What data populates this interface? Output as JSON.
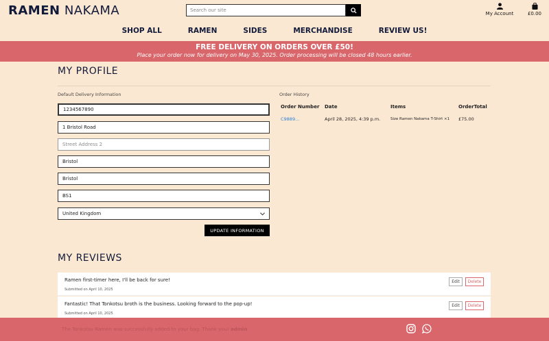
{
  "header": {
    "logo_bold": "RAMEN",
    "logo_light": "NAKAMA",
    "search_placeholder": "Search our site",
    "account_label": "My Account",
    "cart_total": "£0.00"
  },
  "nav": [
    "SHOP ALL",
    "RAMEN",
    "SIDES",
    "MERCHANDISE",
    "REVIEW US!"
  ],
  "banner": {
    "title": "FREE DELIVERY ON ORDERS OVER £50!",
    "subtitle": "Place your order now for delivery on May 30, 2025. Order processing will be closed 48 hours earlier."
  },
  "profile": {
    "title": "MY PROFILE",
    "delivery_label": "Default Delivery Information",
    "fields": {
      "phone": "1234567890",
      "street1": "1 Bristol Road",
      "street2_placeholder": "Street Address 2",
      "town": "Bristol",
      "county": "Bristol",
      "postcode": "BS1",
      "country": "United Kingdom"
    },
    "update_button": "UPDATE INFORMATION"
  },
  "order_history": {
    "label": "Order History",
    "columns": [
      "Order Number",
      "Date",
      "Items",
      "OrderTotal"
    ],
    "rows": [
      {
        "number": "C9889...",
        "date": "April 28, 2025, 4:39 p.m.",
        "items": "Size Ramen Nakama T-Shirt ×1",
        "total": "£75.00"
      }
    ]
  },
  "reviews": {
    "title": "MY REVIEWS",
    "edit_label": "Edit",
    "delete_label": "Delete",
    "items": [
      {
        "text": "Ramen first-timer here, I'll be back for sure!",
        "submitted": "Submitted on April 10, 2025"
      },
      {
        "text": "Fantastic! That Tonkotsu broth is the business. Looking forward to the pop-up!",
        "submitted": "Submitted on April 10, 2025"
      }
    ]
  },
  "footer": {
    "message": "The Tonkotsu Ramen was successfully added to your bag. Thank you!",
    "admin": "admin"
  },
  "colors": {
    "accent": "#d9666b",
    "background": "#fbe8d3",
    "navy": "#111a3a",
    "link": "#2a7fd6"
  },
  "icons": [
    "search-icon",
    "user-icon",
    "bag-icon",
    "chevron-down-icon",
    "instagram-icon",
    "whatsapp-icon"
  ]
}
